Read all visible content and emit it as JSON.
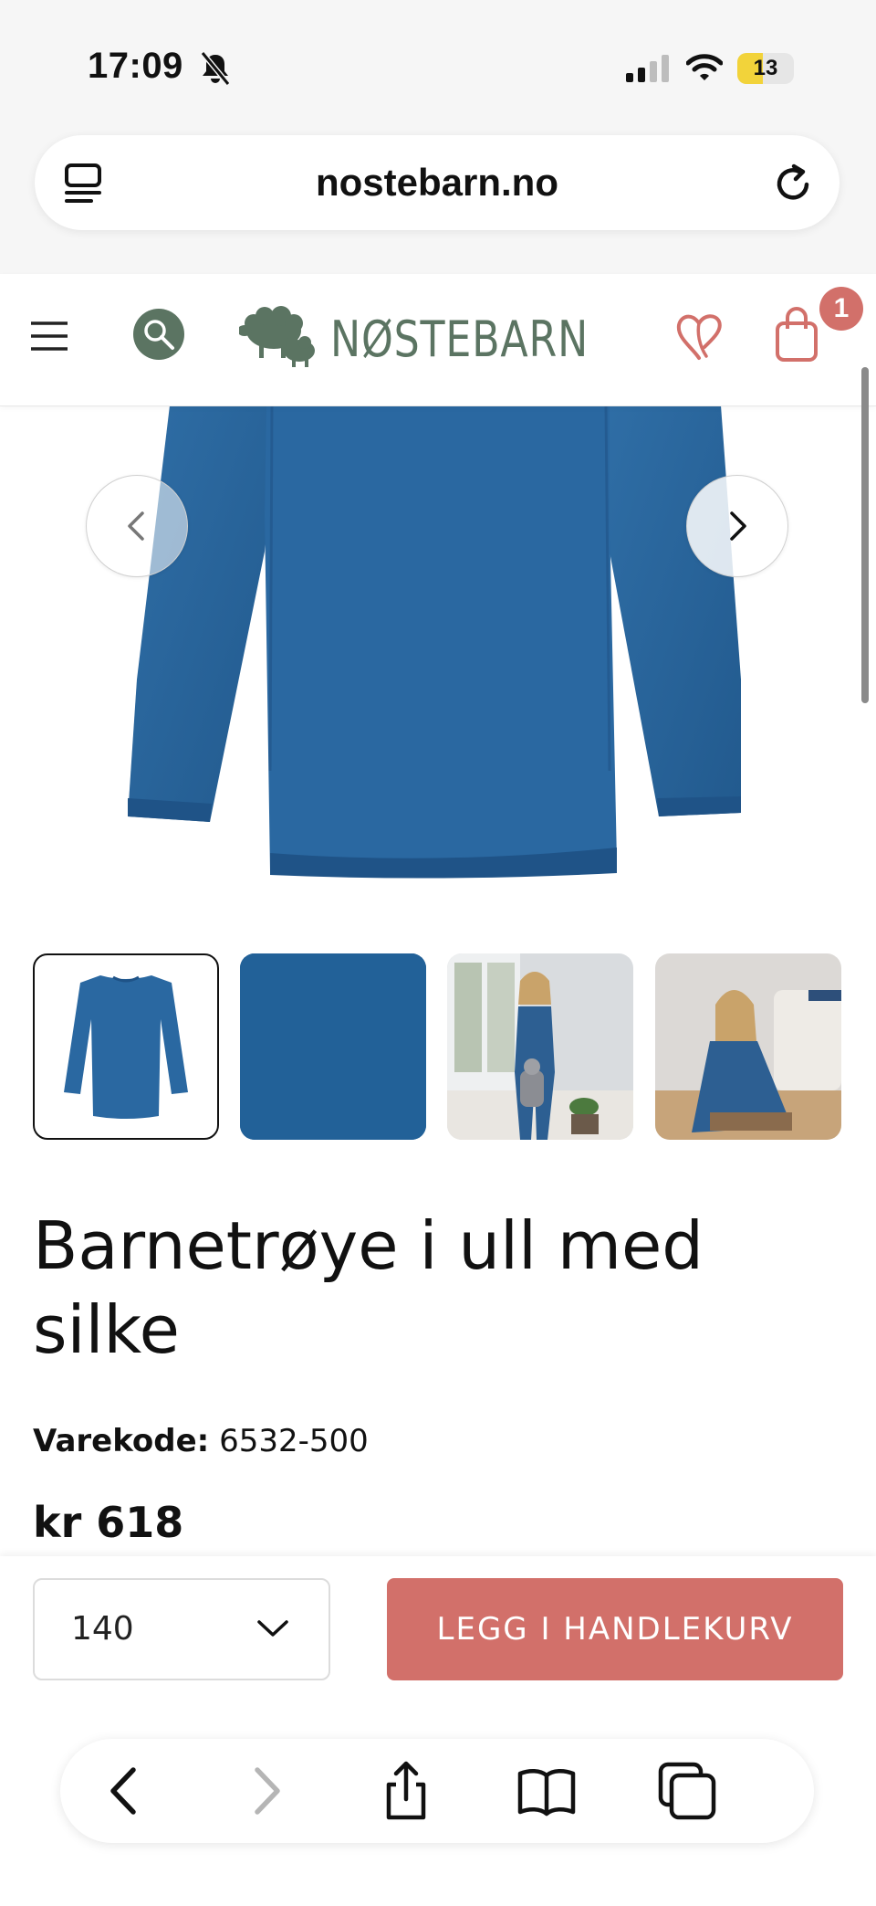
{
  "status_bar": {
    "time": "17:09",
    "battery": "13"
  },
  "browser": {
    "url": "nostebarn.no"
  },
  "header": {
    "logo_text": "NØSTEBARN",
    "cart_count": "1"
  },
  "product": {
    "title": "Barnetrøye i ull med silke",
    "sku_label": "Varekode:",
    "sku_value": "6532-500",
    "price": "kr 618"
  },
  "purchase": {
    "selected_size": "140",
    "add_to_cart_label": "LEGG I HANDLEKURV"
  },
  "colors": {
    "brand_green": "#5b7462",
    "accent_red": "#d2706a",
    "garment_blue": "#2d6aa0"
  },
  "icons": [
    "bell-slash-icon",
    "signal-icon",
    "wifi-icon",
    "tabs-icon",
    "reload-icon",
    "menu-icon",
    "search-icon",
    "heart-icon",
    "bag-icon",
    "chevron-left-icon",
    "chevron-right-icon",
    "chevron-down-icon",
    "back-icon",
    "forward-icon",
    "share-icon",
    "bookmarks-icon",
    "tabs-overview-icon"
  ]
}
